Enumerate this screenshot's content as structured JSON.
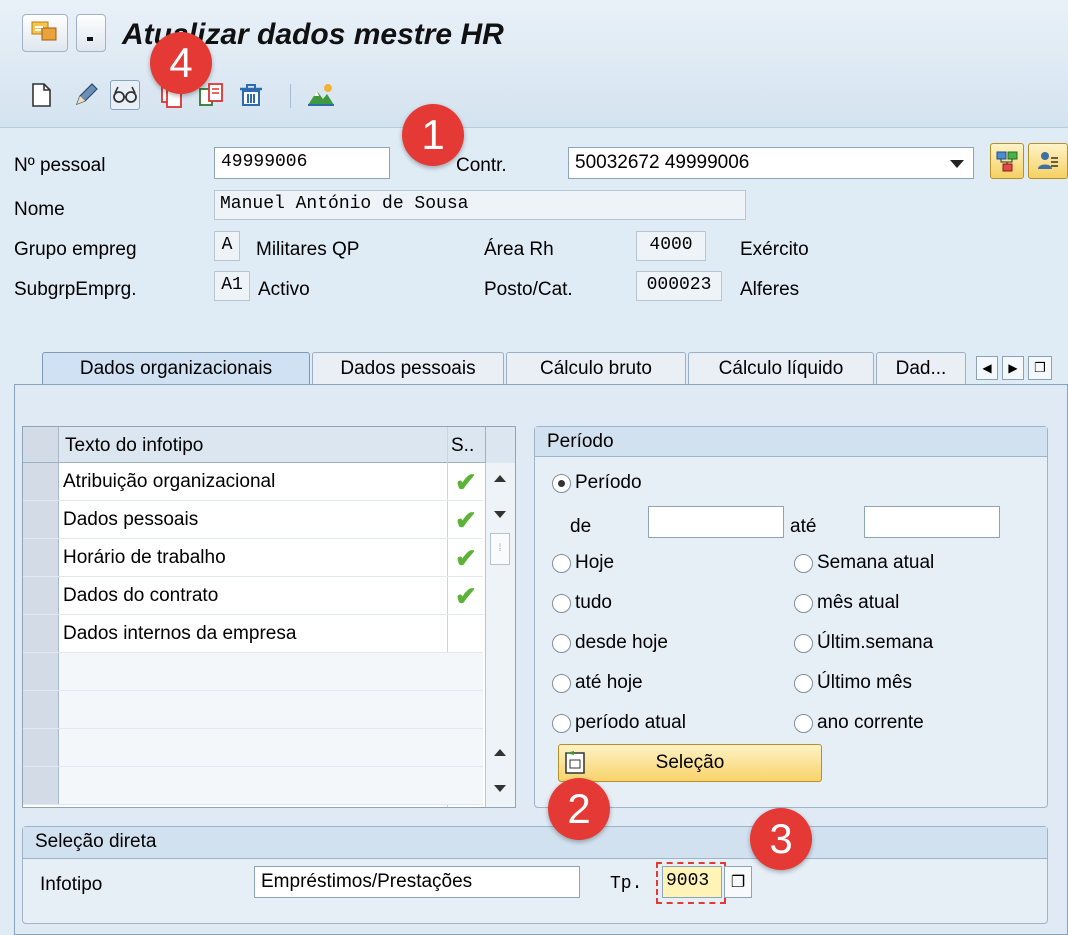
{
  "window": {
    "title": "Atualizar dados mestre HR"
  },
  "toolbar": {
    "icons": [
      "create-icon",
      "change-icon",
      "display-icon",
      "copy-icon",
      "delimit-icon",
      "delete-icon",
      "overview-icon"
    ]
  },
  "header": {
    "personnel_label": "Nº pessoal",
    "personnel_value": "49999006",
    "contract_label": "Contr.",
    "contract_value": "50032672 49999006",
    "name_label": "Nome",
    "name_value": "Manuel António de Sousa",
    "emp_group_label": "Grupo empreg",
    "emp_group_code": "A",
    "emp_group_text": "Militares QP",
    "hr_area_label": "Área Rh",
    "hr_area_code": "4000",
    "hr_area_text": "Exército",
    "emp_subgroup_label": "SubgrpEmprg.",
    "emp_subgroup_code": "A1",
    "emp_subgroup_text": "Activo",
    "post_label": "Posto/Cat.",
    "post_code": "000023",
    "post_text": "Alferes"
  },
  "tabs": [
    {
      "label": "Dados organizacionais",
      "active": true
    },
    {
      "label": "Dados pessoais"
    },
    {
      "label": "Cálculo bruto"
    },
    {
      "label": "Cálculo líquido"
    },
    {
      "label": "Dad..."
    }
  ],
  "infotype_table": {
    "columns": [
      "Texto do infotipo",
      "S.."
    ],
    "rows": [
      {
        "text": "Atribuição organizacional",
        "status": "✔"
      },
      {
        "text": "Dados pessoais",
        "status": "✔"
      },
      {
        "text": "Horário de trabalho",
        "status": "✔"
      },
      {
        "text": "Dados do contrato",
        "status": "✔"
      },
      {
        "text": "Dados internos da empresa",
        "status": ""
      }
    ]
  },
  "period": {
    "title": "Período",
    "period_option": "Período",
    "from_label": "de",
    "to_label": "até",
    "from_value": "",
    "to_value": "",
    "options_left": [
      "Hoje",
      "tudo",
      "desde hoje",
      "até hoje",
      "período atual"
    ],
    "options_right": [
      "Semana atual",
      "mês atual",
      "Últim.semana",
      "Último mês",
      "ano corrente"
    ],
    "selection_button": "Seleção"
  },
  "direct": {
    "title": "Seleção direta",
    "infotype_label": "Infotipo",
    "infotype_value": "Empréstimos/Prestações",
    "type_label": "Tp.",
    "type_value": "9003"
  },
  "annotations": [
    "1",
    "2",
    "3",
    "4"
  ],
  "colors": {
    "accent_red": "#e53935",
    "button_yellow": "#f7d36b",
    "check_green": "#5cb338"
  }
}
